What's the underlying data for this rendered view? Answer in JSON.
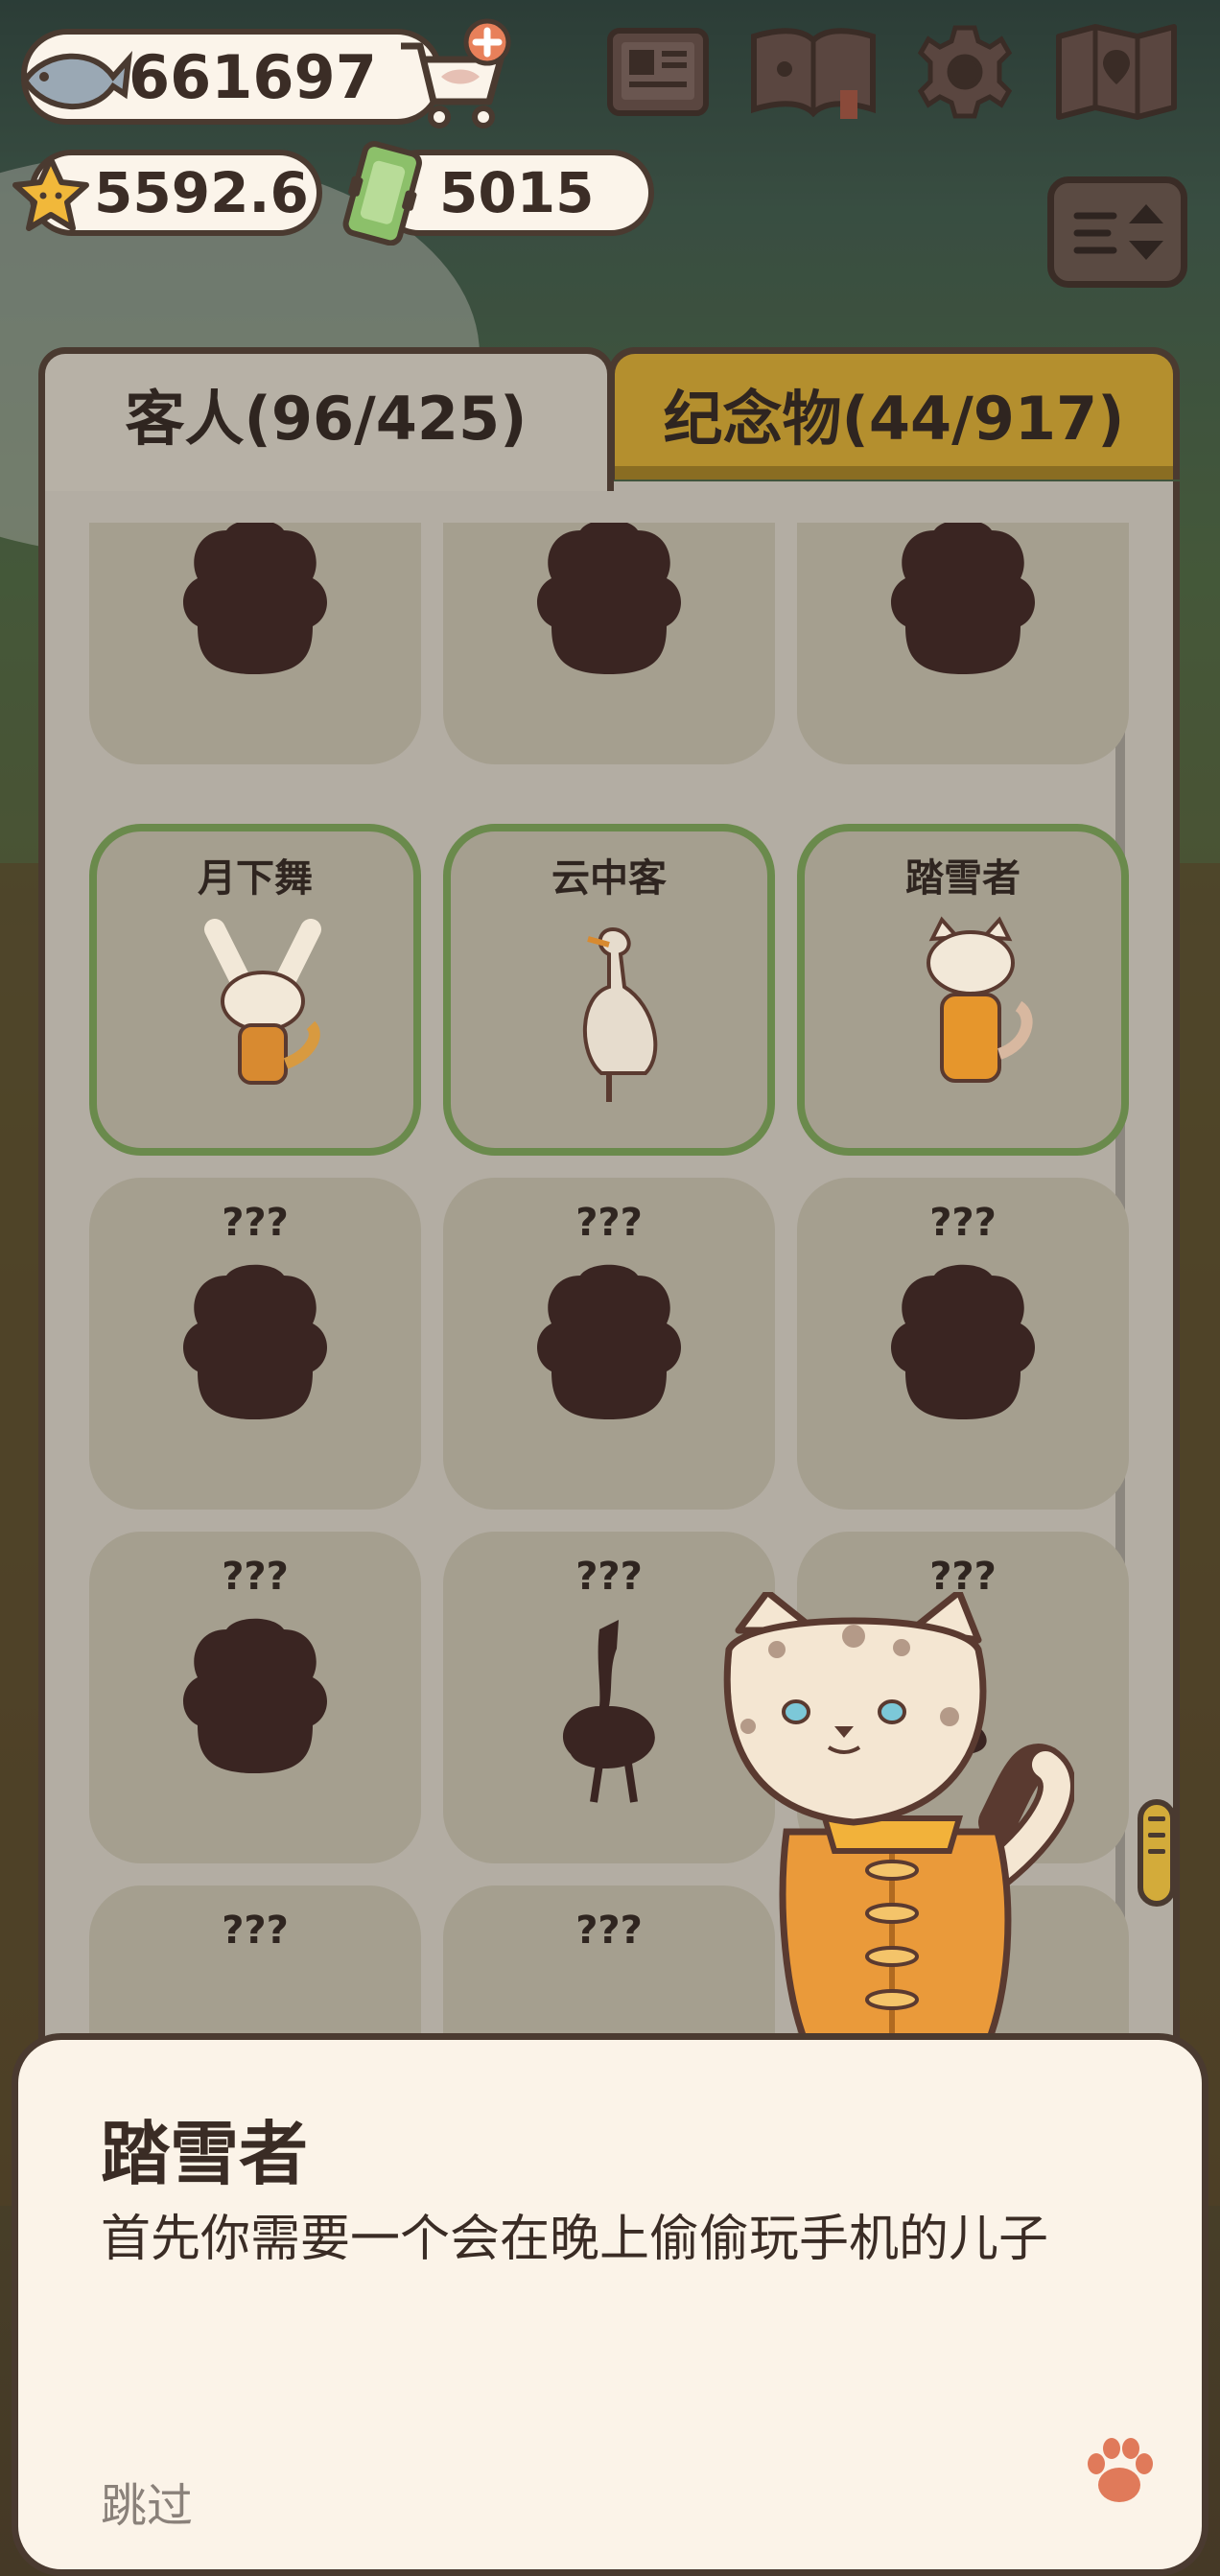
{
  "hud": {
    "fish_value": "661697",
    "star_value": "5592.6",
    "ticket_value": "5015"
  },
  "icons": {
    "fish": "fish-icon",
    "cart": "shop-cart-plus-icon",
    "star": "star-icon",
    "ticket": "ticket-icon",
    "top_buttons": [
      "newspaper-icon",
      "pawbook-icon",
      "gear-icon",
      "map-icon"
    ],
    "sort": "sort-toggle-icon",
    "paw": "paw-icon"
  },
  "tabs": {
    "guests": "客人(96/425)",
    "souvenirs": "纪念物(44/917)"
  },
  "colors": {
    "accent_gold": "#b48f2e",
    "found_border": "#6a8a4c",
    "silhouette": "#3a2522",
    "dialog_bg": "#fbf3e8"
  },
  "cards": [
    {
      "name": "???",
      "found": false,
      "row": 0,
      "col": 0
    },
    {
      "name": "???",
      "found": false,
      "row": 0,
      "col": 1
    },
    {
      "name": "???",
      "found": false,
      "row": 0,
      "col": 2
    },
    {
      "name": "月下舞",
      "found": true,
      "row": 1,
      "col": 0
    },
    {
      "name": "云中客",
      "found": true,
      "row": 1,
      "col": 1
    },
    {
      "name": "踏雪者",
      "found": true,
      "row": 1,
      "col": 2
    },
    {
      "name": "???",
      "found": false,
      "row": 2,
      "col": 0
    },
    {
      "name": "???",
      "found": false,
      "row": 2,
      "col": 1
    },
    {
      "name": "???",
      "found": false,
      "row": 2,
      "col": 2
    },
    {
      "name": "???",
      "found": false,
      "row": 3,
      "col": 0
    },
    {
      "name": "???",
      "found": false,
      "row": 3,
      "col": 1
    },
    {
      "name": "???",
      "found": false,
      "row": 3,
      "col": 2
    },
    {
      "name": "???",
      "found": false,
      "row": 4,
      "col": 0
    },
    {
      "name": "???",
      "found": false,
      "row": 4,
      "col": 1
    },
    {
      "name": "???",
      "found": false,
      "row": 4,
      "col": 2
    }
  ],
  "dialog": {
    "title": "踏雪者",
    "text": "首先你需要一个会在晚上偷偷玩手机的儿子",
    "skip": "跳过"
  }
}
